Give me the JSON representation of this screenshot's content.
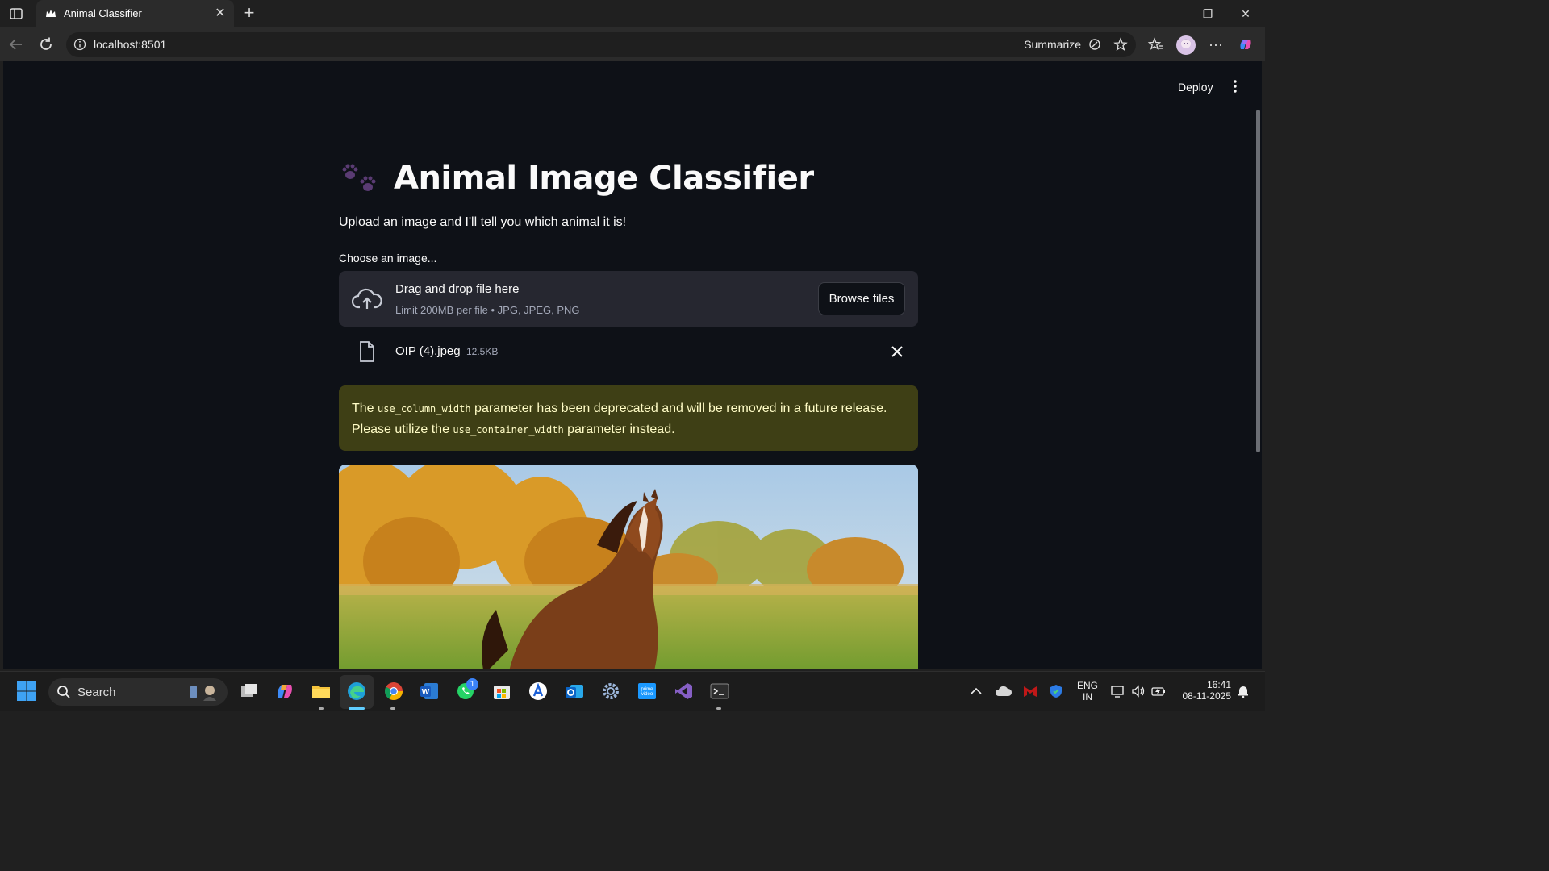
{
  "browser": {
    "tab_title": "Animal Classifier",
    "url": "localhost:8501",
    "summarize_label": "Summarize"
  },
  "app": {
    "deploy_label": "Deploy",
    "title": "Animal Image Classifier",
    "subtitle": "Upload an image and I'll tell you which animal it is!",
    "uploader": {
      "label": "Choose an image...",
      "drag_text": "Drag and drop file here",
      "limit_text": "Limit 200MB per file • JPG, JPEG, PNG",
      "browse_label": "Browse files"
    },
    "file": {
      "name": "OIP (4).jpeg",
      "size": "12.5KB"
    },
    "warning": {
      "part1": "The ",
      "code1": "use_column_width",
      "part2": " parameter has been deprecated and will be removed in a future release. Please utilize the ",
      "code2": "use_container_width",
      "part3": " parameter instead."
    }
  },
  "taskbar": {
    "search_label": "Search",
    "lang_line1": "ENG",
    "lang_line2": "IN",
    "time": "16:41",
    "date": "08-11-2025",
    "whatsapp_badge": "1"
  },
  "icons": {
    "tab_favicon": "streamlit-crown-icon",
    "paw": "paw-prints-icon",
    "upload": "cloud-upload-icon",
    "file": "file-icon",
    "remove": "close-icon"
  },
  "colors": {
    "page_bg": "#0e1117",
    "dropzone_bg": "#262730",
    "warning_bg": "#3e3f15",
    "warning_text": "#fffcc6"
  }
}
